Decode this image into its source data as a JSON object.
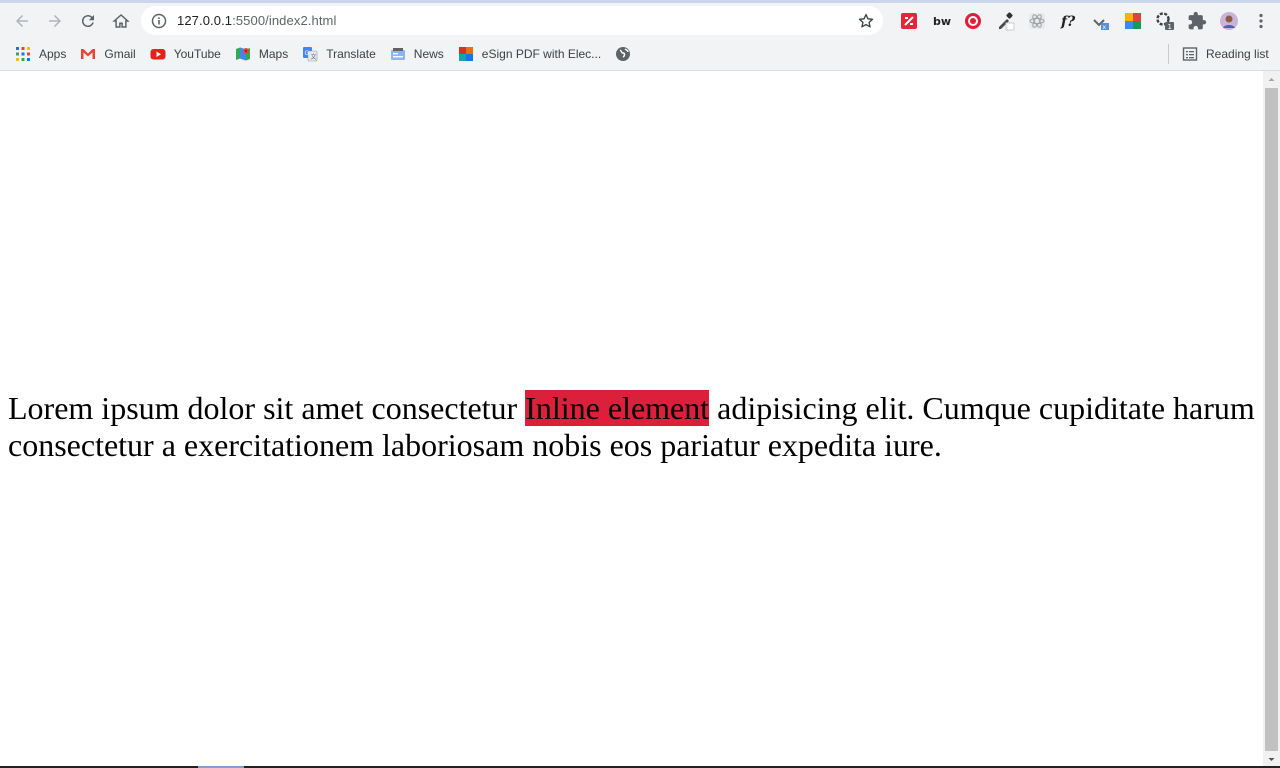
{
  "browser": {
    "url_host": "127.0.0.1",
    "url_path": ":5500/index2.html",
    "bookmarks": [
      {
        "label": "Apps",
        "icon": "apps-grid-icon"
      },
      {
        "label": "Gmail",
        "icon": "gmail-icon"
      },
      {
        "label": "YouTube",
        "icon": "youtube-icon"
      },
      {
        "label": "Maps",
        "icon": "maps-icon"
      },
      {
        "label": "Translate",
        "icon": "translate-icon"
      },
      {
        "label": "News",
        "icon": "news-icon"
      },
      {
        "label": "eSign PDF with Elec...",
        "icon": "esign-icon"
      },
      {
        "label": "",
        "icon": "globe-icon"
      }
    ],
    "reading_list": "Reading list",
    "extensions": [
      "pdf-extension-icon",
      "bw-extension-icon",
      "target-extension-icon",
      "eyedropper-extension-icon",
      "react-extension-icon",
      "fonts-extension-icon",
      "downloads-extension-icon",
      "colorful-extension-icon",
      "gear-badge-extension-icon",
      "puzzle-icon",
      "profile-avatar",
      "menu-icon"
    ]
  },
  "page": {
    "text_before": "Lorem ipsum dolor sit amet consectetur ",
    "inline_element": "Inline element",
    "text_after": " adipisicing elit. Cumque cupiditate harum consectetur a exercitationem laboriosam nobis eos pariatur expedita iure.",
    "inline_bg": "#dc1f3a"
  }
}
